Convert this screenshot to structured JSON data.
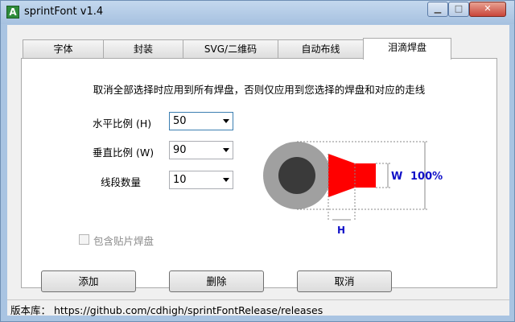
{
  "window": {
    "title": "sprintFont v1.4",
    "app_icon_letter": "A"
  },
  "tabs": [
    {
      "label": "字体",
      "active": false
    },
    {
      "label": "封装",
      "active": false
    },
    {
      "label": "SVG/二维码",
      "active": false
    },
    {
      "label": "自动布线",
      "active": false
    },
    {
      "label": "泪滴焊盘",
      "active": true
    }
  ],
  "teardrop": {
    "note": "取消全部选择时应用到所有焊盘，否则仅应用到您选择的焊盘和对应的走线",
    "fields": [
      {
        "label": "水平比例 (H)",
        "value": "50"
      },
      {
        "label": "垂直比例 (W)",
        "value": "90"
      },
      {
        "label": "线段数量",
        "value": "10"
      }
    ],
    "checkbox": {
      "label": "包含贴片焊盘",
      "checked": false,
      "disabled": true
    },
    "buttons": {
      "add": "添加",
      "delete": "删除",
      "cancel": "取消"
    },
    "diagram": {
      "w_label": "W",
      "h_label": "H",
      "pct_label": "100%",
      "pad_outer_color": "#a0a0a0",
      "pad_inner_color": "#3a3a3a",
      "teardrop_color": "#ff0000",
      "label_color": "#1010c8"
    }
  },
  "statusbar": {
    "text": "版本库： https://github.com/cdhigh/sprintFontRelease/releases"
  }
}
